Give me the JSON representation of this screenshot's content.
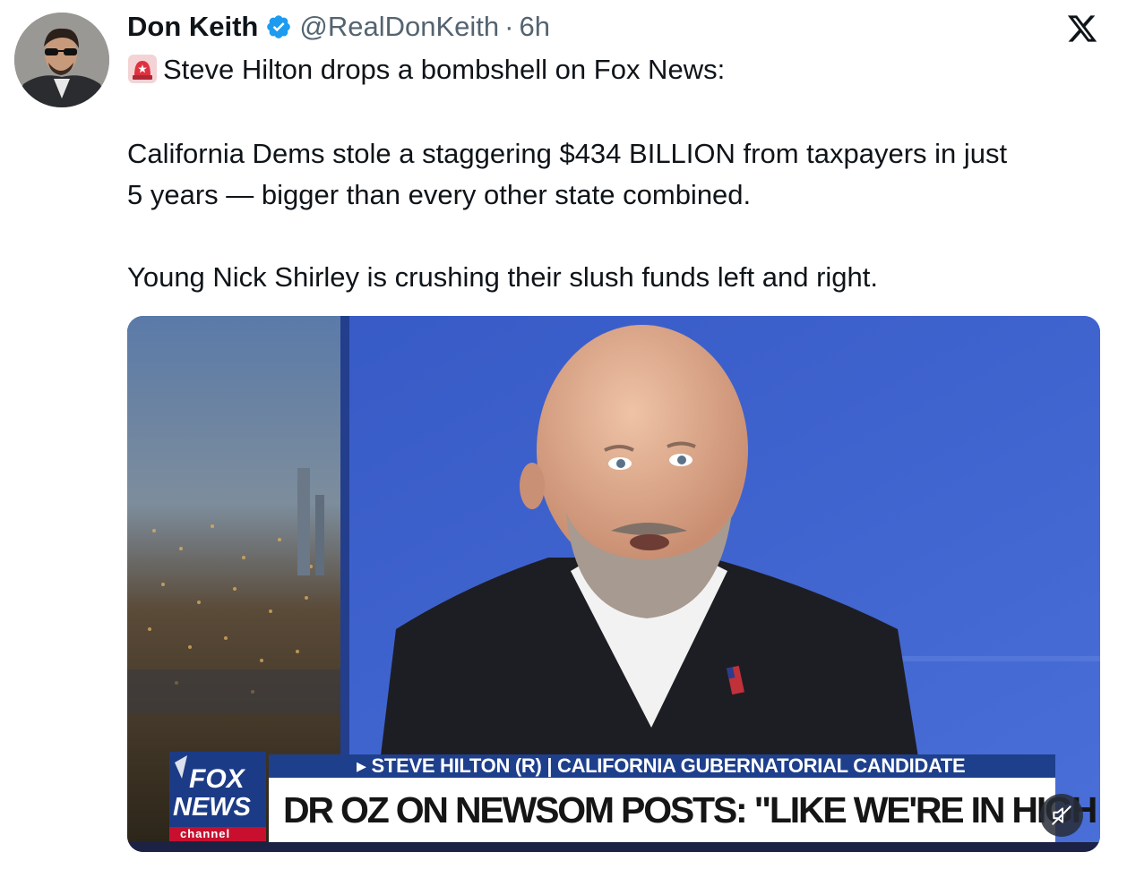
{
  "author": {
    "name": "Don Keith",
    "handle": "@RealDonKeith",
    "separator": "·",
    "time": "6h",
    "verified": true
  },
  "platform_logo": "x-logo-icon",
  "tweet": {
    "emoji": "rotating-light-icon",
    "line1": "Steve Hilton drops a bombshell on Fox News:",
    "line2": "California Dems stole a staggering $434 BILLION from taxpayers in just",
    "line3": "5 years — bigger than every other state combined.",
    "line4": "Young Nick Shirley is crushing their slush funds left and right."
  },
  "video": {
    "chyron_top": "▸ STEVE HILTON (R) | CALIFORNIA GUBERNATORIAL CANDIDATE",
    "chyron_main": "DR OZ ON NEWSOM POSTS: \"LIKE WE'RE IN HIGH SCHOOL\"",
    "logo_line1": "FOX",
    "logo_line2": "NEWS",
    "logo_line3": "channel",
    "mute_icon": "muted-speaker-icon"
  },
  "colors": {
    "verified_blue": "#1d9bf0",
    "secondary_text": "#536471",
    "fox_blue": "#1e3f8c",
    "studio_blue": "#3a5fc8"
  }
}
